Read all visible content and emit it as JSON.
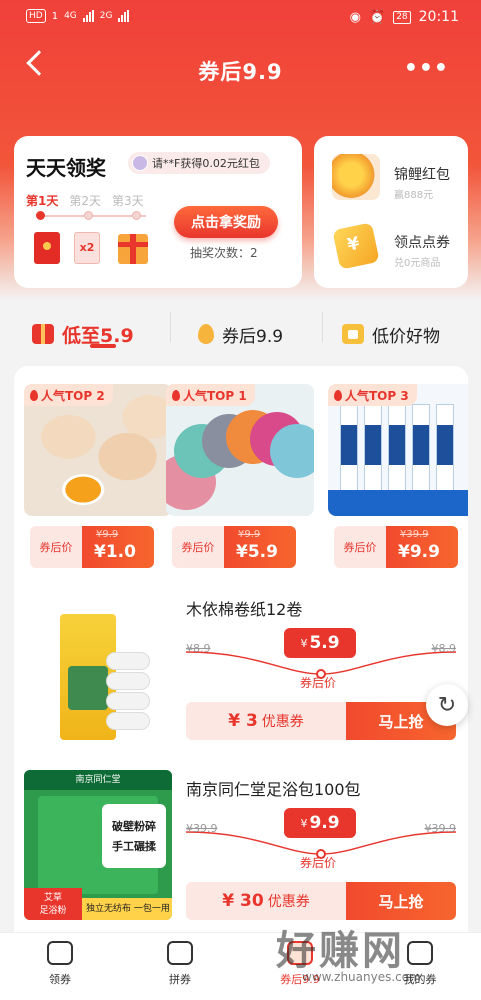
{
  "status": {
    "left_chips": [
      "HD",
      "1"
    ],
    "net1": "4G",
    "net2": "2G",
    "battery": "28",
    "time": "20:11"
  },
  "nav": {
    "title": "券后9.9"
  },
  "lottery": {
    "title": "天天领奖",
    "winner_text": "请**F获得0.02元红包",
    "days": [
      "第1天",
      "第2天",
      "第3天"
    ],
    "gift2_label": "x2",
    "claim_label": "点击拿奖励",
    "draws_text": "抽奖次数：2"
  },
  "rewards": [
    {
      "title": "锦鲤红包",
      "sub": "赢888元"
    },
    {
      "title": "领点点券",
      "sub": "兑0元商品"
    }
  ],
  "tabs": [
    {
      "label": "低至5.9"
    },
    {
      "label": "券后9.9"
    },
    {
      "label": "低价好物"
    }
  ],
  "top_items": [
    {
      "badge": "人气TOP 2",
      "after_label": "券后价",
      "orig": "¥9.9",
      "price": "¥1.0"
    },
    {
      "badge": "人气TOP 1",
      "after_label": "券后价",
      "orig": "¥9.9",
      "price": "¥5.9"
    },
    {
      "badge": "人气TOP 3",
      "after_label": "券后价",
      "orig": "¥39.9",
      "price": "¥9.9"
    }
  ],
  "products": [
    {
      "name": "木依棉卷纸12卷",
      "price": "5.9",
      "old": "¥8.9",
      "after_label": "券后价",
      "coupon_amount": "¥ 3",
      "coupon_text": "优惠券",
      "cta": "马上抢"
    },
    {
      "name": "南京同仁堂足浴包100包",
      "price": "9.9",
      "old": "¥39.9",
      "after_label": "券后价",
      "coupon_amount": "¥ 30",
      "coupon_text": "优惠券",
      "cta": "马上抢"
    }
  ],
  "product2_img_text": {
    "brand": "南京同仁堂",
    "big1": "破壁粉碎",
    "big2": "手工碾揉",
    "badge1": "艾草",
    "badge2": "足浴粉",
    "banner": "独立无纺布 一包一用"
  },
  "bottom_nav": [
    {
      "label": "领券"
    },
    {
      "label": "拼券"
    },
    {
      "label": "券后9.9"
    },
    {
      "label": "我的券"
    }
  ],
  "watermark": {
    "big": "好赚网",
    "url": "www.zhuanyes.com"
  },
  "colors": {
    "brand": "#e8362d",
    "accent": "#f7652e"
  }
}
